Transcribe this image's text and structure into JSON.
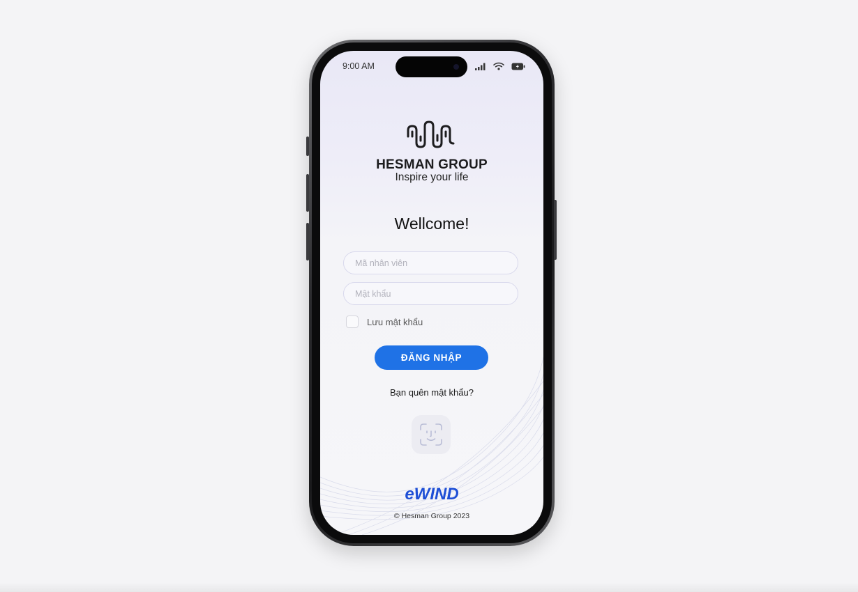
{
  "status_bar": {
    "time": "9:00 AM",
    "icons": [
      "signal-icon",
      "wifi-icon",
      "battery-icon"
    ]
  },
  "brand": {
    "logo_icon": "wave-logo-icon",
    "name": "HESMAN GROUP",
    "tagline": "Inspire your life"
  },
  "login": {
    "heading": "Wellcome!",
    "employee_id": {
      "placeholder": "Mã nhân viên",
      "value": ""
    },
    "password": {
      "placeholder": "Mật khẩu",
      "value": ""
    },
    "remember_label": "Lưu mật khẩu",
    "remember_checked": false,
    "submit_label": "ĐĂNG NHẬP",
    "forgot_label": "Bạn quên mật khẩu?",
    "faceid_icon": "face-id-icon"
  },
  "footer": {
    "app_name": "eWIND",
    "copyright": "© Hesman Group 2023"
  },
  "colors": {
    "primary": "#1f72e6",
    "app_name": "#1e4fd6",
    "background": "#f4f4f6"
  }
}
